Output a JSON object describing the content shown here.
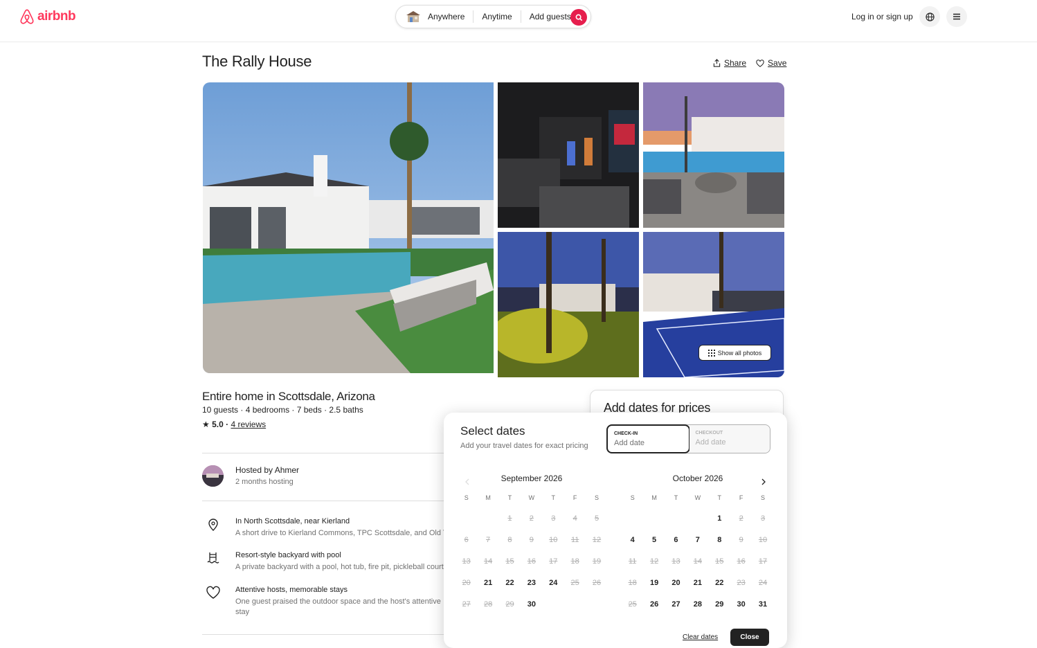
{
  "header": {
    "logo": "airbnb",
    "search": {
      "where": "Anywhere",
      "when": "Anytime",
      "who": "Add guests"
    },
    "login": "Log in or sign up"
  },
  "listing": {
    "title": "The Rally House",
    "share": "Share",
    "save": "Save",
    "show_all_photos": "Show all photos",
    "subtitle": "Entire home in Scottsdale, Arizona",
    "specs": "10 guests · 4 bedrooms · 7 beds · 2.5 baths",
    "rating": "★ 5.0 ·",
    "reviews": "4 reviews",
    "host_name": "Hosted by Ahmer",
    "host_since": "2 months hosting",
    "features": [
      {
        "title": "In North Scottsdale, near Kierland",
        "desc": "A short drive to Kierland Commons, TPC Scottsdale, and Old Town."
      },
      {
        "title": "Resort-style backyard with pool",
        "desc": "A private backyard with a pool, hot tub, fire pit, pickleball court."
      },
      {
        "title": "Attentive hosts, memorable stays",
        "desc": "One guest praised the outdoor space and the host's attentive",
        "desc2": "stay"
      }
    ]
  },
  "price_card": {
    "title": "Add dates for prices"
  },
  "date_picker": {
    "title": "Select dates",
    "subtitle": "Add your travel dates for exact pricing",
    "checkin_label": "CHECK-IN",
    "checkin_value": "Add date",
    "checkout_label": "CHECKOUT",
    "checkout_value": "Add date",
    "clear": "Clear dates",
    "close": "Close",
    "weekdays": [
      "S",
      "M",
      "T",
      "W",
      "T",
      "F",
      "S"
    ],
    "months": [
      {
        "name": "September 2026",
        "offset": 2,
        "days": 30,
        "available": [
          21,
          22,
          23,
          24,
          30
        ]
      },
      {
        "name": "October 2026",
        "offset": 4,
        "days": 31,
        "available": [
          1,
          4,
          5,
          6,
          7,
          8,
          19,
          20,
          21,
          22,
          26,
          27,
          28,
          29,
          30,
          31
        ]
      }
    ]
  },
  "colors": {
    "brand": "#ff385c",
    "text": "#222222",
    "muted": "#717171"
  }
}
